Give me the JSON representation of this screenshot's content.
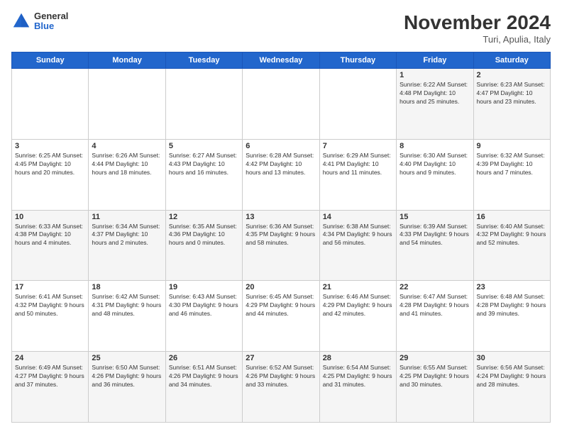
{
  "logo": {
    "general": "General",
    "blue": "Blue"
  },
  "header": {
    "title": "November 2024",
    "location": "Turi, Apulia, Italy"
  },
  "weekdays": [
    "Sunday",
    "Monday",
    "Tuesday",
    "Wednesday",
    "Thursday",
    "Friday",
    "Saturday"
  ],
  "weeks": [
    [
      {
        "day": "",
        "info": ""
      },
      {
        "day": "",
        "info": ""
      },
      {
        "day": "",
        "info": ""
      },
      {
        "day": "",
        "info": ""
      },
      {
        "day": "",
        "info": ""
      },
      {
        "day": "1",
        "info": "Sunrise: 6:22 AM\nSunset: 4:48 PM\nDaylight: 10 hours\nand 25 minutes."
      },
      {
        "day": "2",
        "info": "Sunrise: 6:23 AM\nSunset: 4:47 PM\nDaylight: 10 hours\nand 23 minutes."
      }
    ],
    [
      {
        "day": "3",
        "info": "Sunrise: 6:25 AM\nSunset: 4:45 PM\nDaylight: 10 hours\nand 20 minutes."
      },
      {
        "day": "4",
        "info": "Sunrise: 6:26 AM\nSunset: 4:44 PM\nDaylight: 10 hours\nand 18 minutes."
      },
      {
        "day": "5",
        "info": "Sunrise: 6:27 AM\nSunset: 4:43 PM\nDaylight: 10 hours\nand 16 minutes."
      },
      {
        "day": "6",
        "info": "Sunrise: 6:28 AM\nSunset: 4:42 PM\nDaylight: 10 hours\nand 13 minutes."
      },
      {
        "day": "7",
        "info": "Sunrise: 6:29 AM\nSunset: 4:41 PM\nDaylight: 10 hours\nand 11 minutes."
      },
      {
        "day": "8",
        "info": "Sunrise: 6:30 AM\nSunset: 4:40 PM\nDaylight: 10 hours\nand 9 minutes."
      },
      {
        "day": "9",
        "info": "Sunrise: 6:32 AM\nSunset: 4:39 PM\nDaylight: 10 hours\nand 7 minutes."
      }
    ],
    [
      {
        "day": "10",
        "info": "Sunrise: 6:33 AM\nSunset: 4:38 PM\nDaylight: 10 hours\nand 4 minutes."
      },
      {
        "day": "11",
        "info": "Sunrise: 6:34 AM\nSunset: 4:37 PM\nDaylight: 10 hours\nand 2 minutes."
      },
      {
        "day": "12",
        "info": "Sunrise: 6:35 AM\nSunset: 4:36 PM\nDaylight: 10 hours\nand 0 minutes."
      },
      {
        "day": "13",
        "info": "Sunrise: 6:36 AM\nSunset: 4:35 PM\nDaylight: 9 hours\nand 58 minutes."
      },
      {
        "day": "14",
        "info": "Sunrise: 6:38 AM\nSunset: 4:34 PM\nDaylight: 9 hours\nand 56 minutes."
      },
      {
        "day": "15",
        "info": "Sunrise: 6:39 AM\nSunset: 4:33 PM\nDaylight: 9 hours\nand 54 minutes."
      },
      {
        "day": "16",
        "info": "Sunrise: 6:40 AM\nSunset: 4:32 PM\nDaylight: 9 hours\nand 52 minutes."
      }
    ],
    [
      {
        "day": "17",
        "info": "Sunrise: 6:41 AM\nSunset: 4:32 PM\nDaylight: 9 hours\nand 50 minutes."
      },
      {
        "day": "18",
        "info": "Sunrise: 6:42 AM\nSunset: 4:31 PM\nDaylight: 9 hours\nand 48 minutes."
      },
      {
        "day": "19",
        "info": "Sunrise: 6:43 AM\nSunset: 4:30 PM\nDaylight: 9 hours\nand 46 minutes."
      },
      {
        "day": "20",
        "info": "Sunrise: 6:45 AM\nSunset: 4:29 PM\nDaylight: 9 hours\nand 44 minutes."
      },
      {
        "day": "21",
        "info": "Sunrise: 6:46 AM\nSunset: 4:29 PM\nDaylight: 9 hours\nand 42 minutes."
      },
      {
        "day": "22",
        "info": "Sunrise: 6:47 AM\nSunset: 4:28 PM\nDaylight: 9 hours\nand 41 minutes."
      },
      {
        "day": "23",
        "info": "Sunrise: 6:48 AM\nSunset: 4:28 PM\nDaylight: 9 hours\nand 39 minutes."
      }
    ],
    [
      {
        "day": "24",
        "info": "Sunrise: 6:49 AM\nSunset: 4:27 PM\nDaylight: 9 hours\nand 37 minutes."
      },
      {
        "day": "25",
        "info": "Sunrise: 6:50 AM\nSunset: 4:26 PM\nDaylight: 9 hours\nand 36 minutes."
      },
      {
        "day": "26",
        "info": "Sunrise: 6:51 AM\nSunset: 4:26 PM\nDaylight: 9 hours\nand 34 minutes."
      },
      {
        "day": "27",
        "info": "Sunrise: 6:52 AM\nSunset: 4:26 PM\nDaylight: 9 hours\nand 33 minutes."
      },
      {
        "day": "28",
        "info": "Sunrise: 6:54 AM\nSunset: 4:25 PM\nDaylight: 9 hours\nand 31 minutes."
      },
      {
        "day": "29",
        "info": "Sunrise: 6:55 AM\nSunset: 4:25 PM\nDaylight: 9 hours\nand 30 minutes."
      },
      {
        "day": "30",
        "info": "Sunrise: 6:56 AM\nSunset: 4:24 PM\nDaylight: 9 hours\nand 28 minutes."
      }
    ]
  ]
}
